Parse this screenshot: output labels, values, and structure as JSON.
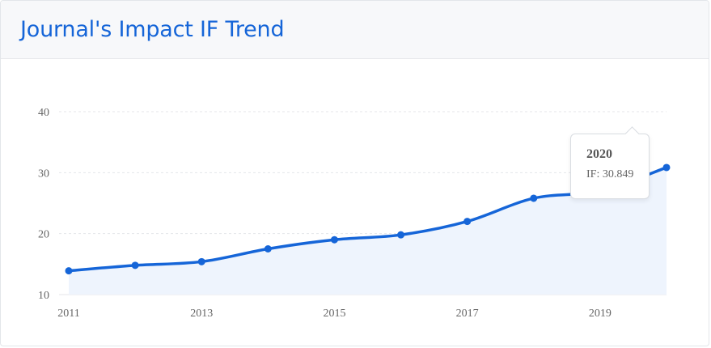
{
  "header": {
    "title": "Journal's Impact IF Trend"
  },
  "tooltip": {
    "year": "2020",
    "label": "IF:",
    "value": "30.849"
  },
  "colors": {
    "line": "#1565d8",
    "area": "#eef4fd",
    "title": "#1565d8",
    "grid": "#e4e6e9"
  },
  "chart_data": {
    "type": "area",
    "title": "Journal's Impact IF Trend",
    "xlabel": "",
    "ylabel": "",
    "x": [
      2011,
      2012,
      2013,
      2014,
      2015,
      2016,
      2017,
      2018,
      2019,
      2020
    ],
    "series": [
      {
        "values": [
          13.9,
          14.8,
          15.4,
          17.5,
          19.0,
          19.8,
          22.0,
          25.8,
          27.0,
          30.849
        ]
      }
    ],
    "xticks": [
      "2011",
      "2013",
      "2015",
      "2017",
      "2019"
    ],
    "yticks": [
      "10",
      "20",
      "30",
      "40"
    ],
    "ylim": [
      10,
      40
    ],
    "grid": "horizontal dashed",
    "legend": "none"
  }
}
